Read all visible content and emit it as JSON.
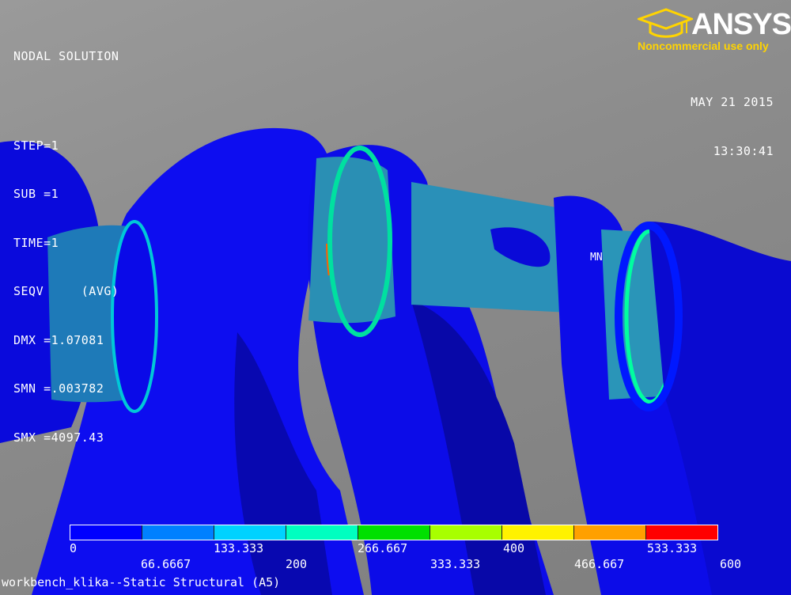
{
  "header": {
    "title": "NODAL SOLUTION",
    "lines": [
      "STEP=1",
      "SUB =1",
      "TIME=1",
      "SEQV     (AVG)",
      "DMX =1.07081",
      "SMN =.003782",
      "SMX =4097.43"
    ]
  },
  "logo": {
    "brand": "ANSYS",
    "tagline": "Noncommercial use only",
    "tagline_color": "#ffd400"
  },
  "datetime": {
    "date": "MAY 21 2015",
    "time": "13:30:41"
  },
  "marker": {
    "label": "MN"
  },
  "legend": {
    "colors": [
      "#0000ff",
      "#0080ff",
      "#00d2ff",
      "#00ffc0",
      "#00e000",
      "#a8ff00",
      "#fff200",
      "#ffa000",
      "#ff0000"
    ],
    "top_labels": [
      "0",
      "133.333",
      "266.667",
      "400",
      "533.333"
    ],
    "bottom_labels": [
      "66.6667",
      "200",
      "333.333",
      "466.667",
      "600"
    ]
  },
  "footer": {
    "title": "workbench_klika--Static Structural (A5)"
  }
}
